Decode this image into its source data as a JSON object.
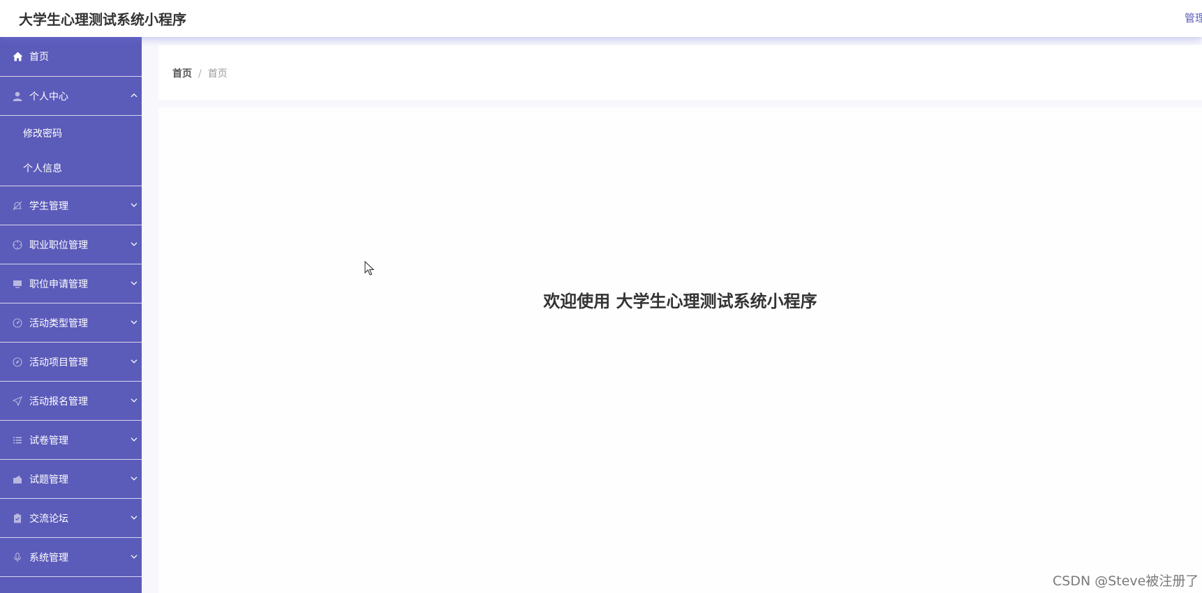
{
  "header": {
    "app_title": "大学生心理测试系统小程序",
    "user_label": "管理"
  },
  "sidebar": {
    "home": {
      "label": "首页",
      "icon": "home-icon"
    },
    "personal_center": {
      "label": "个人中心",
      "icon": "user-icon",
      "expanded": true,
      "children": [
        {
          "label": "修改密码"
        },
        {
          "label": "个人信息"
        }
      ]
    },
    "items": [
      {
        "label": "学生管理",
        "icon": "bell-off-icon"
      },
      {
        "label": "职业职位管理",
        "icon": "crosshair-icon"
      },
      {
        "label": "职位申请管理",
        "icon": "monitor-icon"
      },
      {
        "label": "活动类型管理",
        "icon": "gauge-icon"
      },
      {
        "label": "活动项目管理",
        "icon": "compass-icon"
      },
      {
        "label": "活动报名管理",
        "icon": "send-icon"
      },
      {
        "label": "试卷管理",
        "icon": "list-icon"
      },
      {
        "label": "试题管理",
        "icon": "wallet-icon"
      },
      {
        "label": "交流论坛",
        "icon": "clipboard-check-icon"
      },
      {
        "label": "系统管理",
        "icon": "microphone-icon"
      }
    ]
  },
  "breadcrumb": {
    "root": "首页",
    "separator": "/",
    "current": "首页"
  },
  "main": {
    "welcome_text": "欢迎使用 大学生心理测试系统小程序"
  },
  "watermark": "CSDN @Steve被注册了",
  "colors": {
    "sidebar_bg": "#5b5bba",
    "accent": "#5a5ab8",
    "page_bg": "#f7f7fc"
  }
}
